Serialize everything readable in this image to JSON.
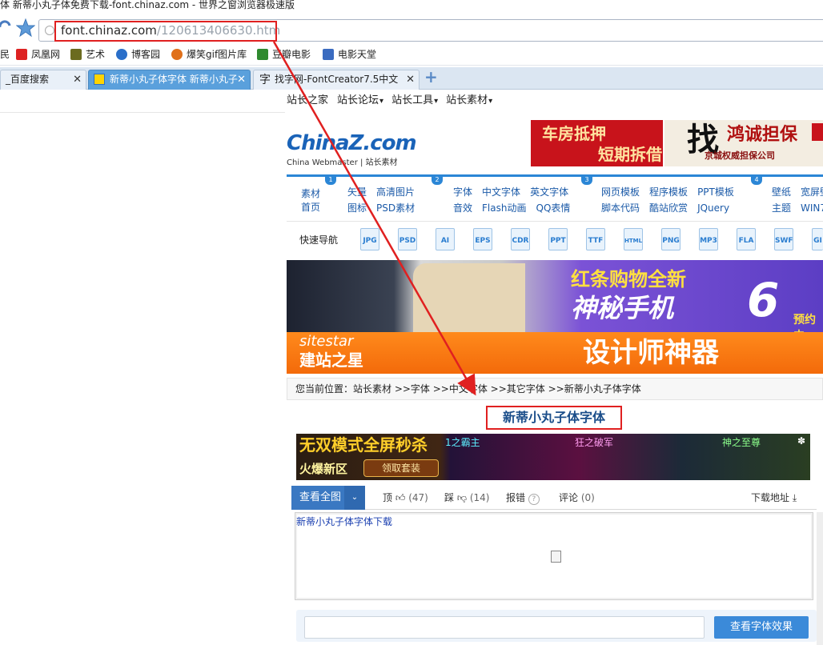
{
  "window": {
    "title": "体 新蒂小丸子体免费下载-font.chinaz.com - 世界之窗浏览器极速版"
  },
  "address": {
    "url_host": "font.chinaz.com",
    "url_path": "/120613406630.htm"
  },
  "bookmarks": [
    {
      "label": "凤凰网",
      "color": "#d22"
    },
    {
      "label": "艺术",
      "color": "#6b6b20"
    },
    {
      "label": "博客园",
      "color": "#2a6fc9"
    },
    {
      "label": "爆笑gif图片库",
      "color": "#e0701a"
    },
    {
      "label": "豆瓣电影",
      "color": "#2f8a2f"
    },
    {
      "label": "电影天堂",
      "color": "#3a6bc0"
    }
  ],
  "tabs": [
    {
      "label": "_百度搜索"
    },
    {
      "label": "新蒂小丸子体字体 新蒂小丸子"
    },
    {
      "label": "找字网-FontCreator7.5中文"
    }
  ],
  "site_nav": [
    "站长之家",
    "站长论坛",
    "站长工具",
    "站长素材"
  ],
  "logo": {
    "text": "ChinaZ.com",
    "sub": "China Webmaster | 站长素材"
  },
  "ads": {
    "ad1_line1": "车房抵押",
    "ad1_line2": "短期拆借",
    "ad2_big": "找",
    "ad2_line1": "鸿诚担保",
    "ad2_line2": "京城权威担保公司",
    "banner1_line1": "红条购物全新",
    "banner1_line2": "神秘手机",
    "banner1_num": "6",
    "banner1_tail": "预约中",
    "banner2_brand": "sitestar",
    "banner2_brand_cn": "建站之星",
    "banner2_slogan": "设计师神器",
    "game_slogan1": "无双模式全屏秒杀",
    "game_slogan2": "火爆新区",
    "game_button": "领取套装",
    "game_tag1": "1之霸主",
    "game_tag2": "狂之破军",
    "game_tag3": "神之至尊"
  },
  "categories": {
    "home": [
      "素材",
      "首页"
    ],
    "groups": [
      {
        "num": "1",
        "row1": [
          "矢量",
          "高清图片"
        ],
        "row2": [
          "图标",
          "PSD素材"
        ]
      },
      {
        "num": "2",
        "row1": [
          "字体",
          "中文字体",
          "英文字体"
        ],
        "row2": [
          "音效",
          "Flash动画",
          "QQ表情"
        ]
      },
      {
        "num": "3",
        "row1": [
          "网页模板",
          "程序模板",
          "PPT模板"
        ],
        "row2": [
          "脚本代码",
          "酷站欣赏",
          "JQuery"
        ]
      },
      {
        "num": "4",
        "row1": [
          "壁纸",
          "宽屏壁"
        ],
        "row2": [
          "主题",
          "WIN7"
        ]
      }
    ]
  },
  "quick_nav": {
    "label": "快速导航",
    "types": [
      "JPG",
      "PSD",
      "AI",
      "EPS",
      "CDR",
      "PPT",
      "TTF",
      "HTML",
      "PNG",
      "MP3",
      "FLA",
      "SWF",
      "GI"
    ]
  },
  "breadcrumb": "您当前位置：站长素材 >>字体 >>中文字体 >>其它字体 >>新蒂小丸子体字体",
  "font_title": "新蒂小丸子体字体",
  "actions": {
    "view_all": "查看全图",
    "up": "顶",
    "up_count": "(47)",
    "down": "踩",
    "down_count": "(14)",
    "report": "报错",
    "comment": "评论",
    "comment_count": "(0)",
    "download": "下载地址"
  },
  "content_text": "新蒂小丸子体字体下载",
  "preview_button": "查看字体效果"
}
